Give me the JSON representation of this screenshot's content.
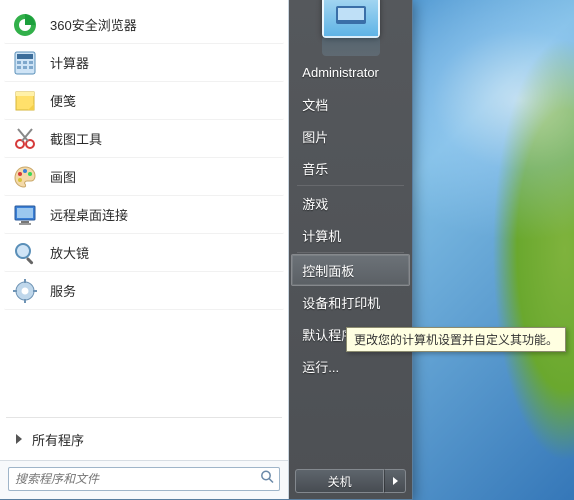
{
  "left": {
    "programs": [
      {
        "label": "360安全浏览器"
      },
      {
        "label": "计算器"
      },
      {
        "label": "便笺"
      },
      {
        "label": "截图工具"
      },
      {
        "label": "画图"
      },
      {
        "label": "远程桌面连接"
      },
      {
        "label": "放大镜"
      },
      {
        "label": "服务"
      }
    ],
    "all_programs": "所有程序",
    "search_placeholder": "搜索程序和文件"
  },
  "right": {
    "user": "Administrator",
    "items": [
      "文档",
      "图片",
      "音乐",
      "游戏",
      "计算机",
      "控制面板",
      "设备和打印机",
      "默认程序",
      "运行..."
    ],
    "control_panel_index": 5,
    "shutdown_label": "关机"
  },
  "tooltip": "更改您的计算机设置并自定义其功能。"
}
